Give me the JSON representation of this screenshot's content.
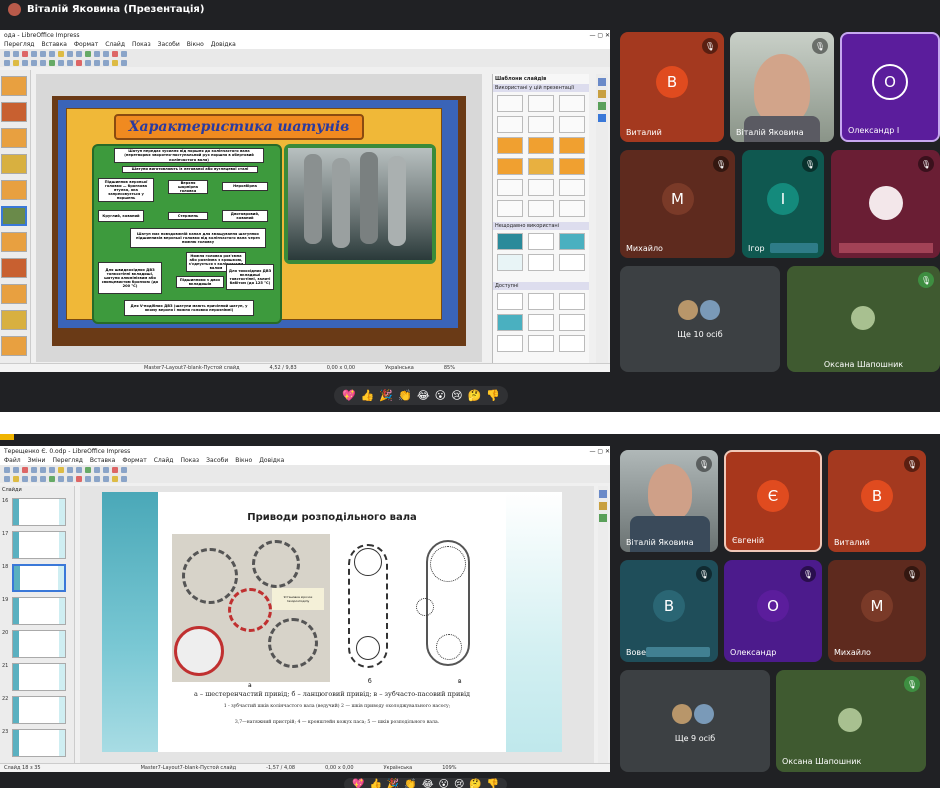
{
  "meet": {
    "presenter_title": "Віталій Яковина (Презентація)"
  },
  "impress_top": {
    "window_title": "ода - LibreOffice Impress",
    "menu": [
      "Перегляд",
      "Вставка",
      "Формат",
      "Слайд",
      "Показ",
      "Засоби",
      "Вікно",
      "Довідка"
    ],
    "slide_title": "Характеристика шатунів",
    "diagram_boxes": [
      "Шатун передає зусилля від поршня до колінчастого вала (перетворює зворотно-поступальний рух поршня в обертовий колінчастого вала)",
      "Шатуни виготовляють із легованої або вуглецевої сталі",
      "Підшипник верхньої головки — бронзова втулка, яка запресовується у поршень",
      "Верхня шарнірна головка",
      "Нерозбірна",
      "Круглий, кований",
      "Стержень",
      "Двотавровий, кований",
      "Шатун має повздовжній канал для змащування шатунних підшипників верхньої головки від колінчастого вала через нижню головку",
      "Нижня головка роз'ємна або рознімна з кришкою, з'єднується з колінчастим валом",
      "Для швидкохідних ДВЗ тонкостінні вкладиші, шатуни алюмінієвим або свинцевистим бронзою (до 200 °С)",
      "Підшипники з двох вкладишів",
      "Для тихохідних ДВЗ вкладиші товстостінні, залиті бабітом (до 125 °С)",
      "Для V-подібних ДВЗ (шатуни мають причіпний шатун, у якому верхня і нижня головки нерознімні)"
    ],
    "templates_panel": {
      "title": "Шаблони слайдів",
      "used_label": "Використані у цій презентації",
      "recent_label": "Нещодавно використані",
      "available_label": "Доступні"
    },
    "status": {
      "layout": "Master7-Layout7-blank-Пустой слайд",
      "coords": "4,52 / 9,83",
      "size": "0,00 x 0,00",
      "lang": "Українська",
      "zoom": "85%"
    }
  },
  "participants_top": [
    {
      "name": "Виталий",
      "letter": "В",
      "color": "#a4391f",
      "letter_bg": "#e04b1f"
    },
    {
      "name": "Віталій Яковина",
      "video": true
    },
    {
      "name": "Олександр І",
      "letter": "О",
      "color": "#5b1d9c",
      "letter_bg": "#5b1d9c"
    },
    {
      "name": "Михайло",
      "letter": "М",
      "color": "#5e2a1e",
      "letter_bg": "#7a3a28"
    },
    {
      "name": "Ігор",
      "letter": "І",
      "color": "#0f5850",
      "letter_bg": "#148a7c"
    },
    {
      "name": "",
      "cartoon": true
    },
    {
      "name": "Ще 10 осіб"
    },
    {
      "name": "Оксана Шапошник"
    }
  ],
  "reactions": [
    "💖",
    "👍",
    "🎉",
    "👏",
    "😂",
    "😮",
    "😢",
    "🤔",
    "👎"
  ],
  "impress_bottom": {
    "window_title": "Терещенко Є. 0.odp - LibreOffice Impress",
    "menu": [
      "Файл",
      "Зміни",
      "Перегляд",
      "Вставка",
      "Формат",
      "Слайд",
      "Показ",
      "Засоби",
      "Вікно",
      "Довідка"
    ],
    "slides_label": "Слайди",
    "slide_numbers": [
      "16",
      "17",
      "18",
      "19",
      "20",
      "21",
      "22",
      "23"
    ],
    "slide_title": "Приводи розподільного вала",
    "fig_labels": [
      "а",
      "б",
      "в"
    ],
    "caption": "а – шестеренчастий привід;  б – ланцюговий привід; в – зубчасто-пасовий привід",
    "legend_lines": [
      "1 - зубчастий шків колінчастого вала (ведучий) 2 — шків приводу охолоджувального насосу;",
      "3,7—натяжний пристрій; 4 — кронштейн кожух паса; 5 — шків розподільного вала."
    ],
    "photo_note": "Установка зірочок газорозподілу",
    "status": {
      "slide": "Слайд 18 з 35",
      "layout": "Master7-Layout7-blank-Пустой слайд",
      "coords": "-1,57 / 4,08",
      "size": "0,00 x 0,00",
      "lang": "Українська",
      "zoom": "109%"
    }
  },
  "participants_bottom": [
    {
      "name": "Віталій Яковина",
      "video": true
    },
    {
      "name": "Євгеній",
      "letter": "Є",
      "color": "#a8371c",
      "letter_bg": "#e04b1f"
    },
    {
      "name": "Виталий",
      "letter": "В",
      "color": "#a4391f",
      "letter_bg": "#e04b1f"
    },
    {
      "name": "Вове",
      "letter": "В",
      "color": "#1f4e5a",
      "letter_bg": "#2a6674"
    },
    {
      "name": "Олександр",
      "letter": "О",
      "color": "#4c1b8c",
      "letter_bg": "#5b1d9c"
    },
    {
      "name": "Михайло",
      "letter": "М",
      "color": "#5e2a1e",
      "letter_bg": "#7a3a28"
    },
    {
      "name": "Ще 9 осіб"
    },
    {
      "name": "Оксана Шапошник"
    }
  ]
}
